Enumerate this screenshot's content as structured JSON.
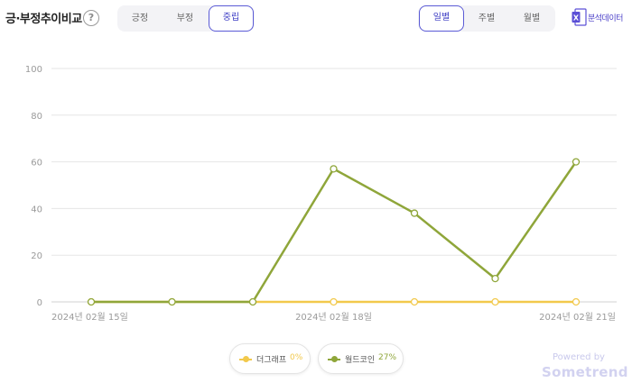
{
  "header": {
    "title": "긍·부정추이비교",
    "help_icon": "question-circle-icon",
    "sentiment_tabs": [
      {
        "label": "긍정",
        "active": false
      },
      {
        "label": "부정",
        "active": false
      },
      {
        "label": "중립",
        "active": true
      }
    ],
    "period_tabs": [
      {
        "label": "일별",
        "active": true
      },
      {
        "label": "주별",
        "active": false
      },
      {
        "label": "월별",
        "active": false
      }
    ],
    "export_label": "분석데이터",
    "export_icon": "excel-file-icon",
    "accent_color": "#5b5bd6"
  },
  "chart_data": {
    "type": "line",
    "x": [
      "2024-02-15",
      "2024-02-16",
      "2024-02-17",
      "2024-02-18",
      "2024-02-19",
      "2024-02-20",
      "2024-02-21"
    ],
    "x_tick_labels": [
      "2024년 02월 15일",
      "2024년 02월 18일",
      "2024년 02월 21일"
    ],
    "y_ticks": [
      0,
      20,
      40,
      60,
      80,
      100
    ],
    "ylim": [
      0,
      100
    ],
    "grid": true,
    "series": [
      {
        "name": "더그래프",
        "percent": "0%",
        "color": "#f2c94c",
        "values": [
          0,
          0,
          0,
          0,
          0,
          0,
          0
        ]
      },
      {
        "name": "월드코인",
        "percent": "27%",
        "color": "#8fa63a",
        "values": [
          0,
          0,
          0,
          57,
          38,
          10,
          60
        ]
      }
    ],
    "legend_position": "bottom-center"
  },
  "footer": {
    "powered_by": "Powered by",
    "brand": "Sometrend"
  }
}
